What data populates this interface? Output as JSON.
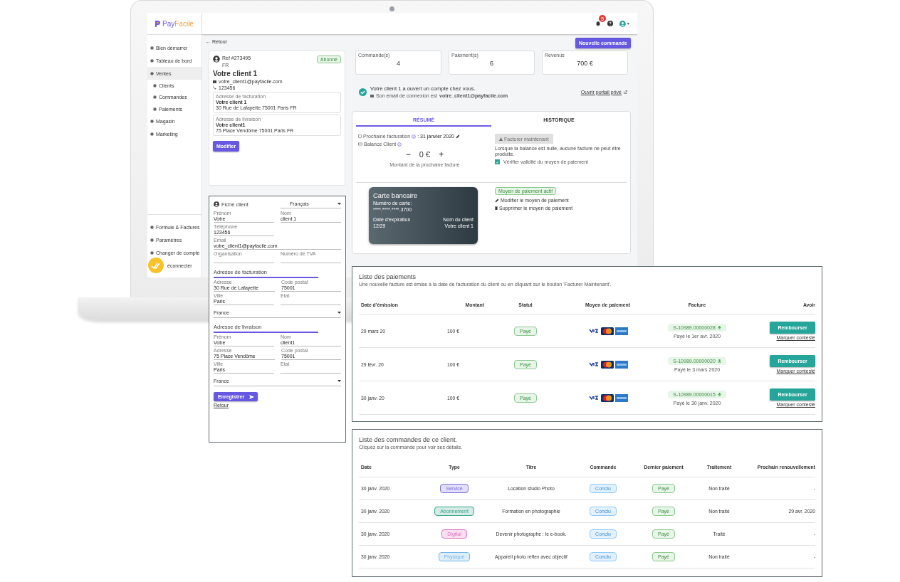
{
  "app": {
    "logo_parts": [
      "Pay",
      "Facile"
    ],
    "notifications_count": "5"
  },
  "sidebar": {
    "items": [
      {
        "label": "Bien démarrer",
        "selected": false
      },
      {
        "label": "Tableau de bord",
        "selected": false
      },
      {
        "label": "Ventes",
        "selected": true,
        "children": [
          {
            "label": "Clients",
            "selected": false
          },
          {
            "label": "Commandes",
            "selected": false
          },
          {
            "label": "Paiements",
            "selected": false
          }
        ]
      },
      {
        "label": "Magasin",
        "selected": false
      },
      {
        "label": "Marketing",
        "selected": false
      }
    ],
    "bottom_items": [
      "Formule & Factures",
      "Paramètres",
      "Changer de compte",
      "éconnecter"
    ]
  },
  "back_link": "← Retour",
  "new_order_button": "Nouvelle commande",
  "client": {
    "ref": "Ref #273495",
    "country": "FR",
    "status": "Abonné",
    "name": "Votre client 1",
    "email": "votre_client1@payfacile.com",
    "phone": "123456",
    "billing": {
      "label": "Adresse de facturation",
      "name": "Votre client 1",
      "address": "30 Rue de Lafayette 75001 Paris FR"
    },
    "shipping": {
      "label": "Adresse de livraison",
      "name": "Votre client1",
      "address": "75 Place Vendôme 75001 Paris FR"
    },
    "edit_button": "Modifier"
  },
  "stats": [
    {
      "label": "Commande(s)",
      "value": "4"
    },
    {
      "label": "Paiement(s)",
      "value": "6"
    },
    {
      "label": "Revenus",
      "value": "700 €"
    }
  ],
  "account_notice": {
    "title": "Votre client 1 a ouvert un compte chez vous.",
    "login_label": "Son email de connexion est",
    "login_email": "votre_client1@payfacile.com",
    "portal_link": "Ouvrir portail privé"
  },
  "tabs": [
    {
      "label": "RÉSUMÉ",
      "selected": true
    },
    {
      "label": "HISTORIQUE",
      "selected": false
    }
  ],
  "summary": {
    "next_billing_label": "Prochaine facturation",
    "next_billing_date": ": 31 janvier 2020",
    "balance_label": "Balance Client",
    "balance_minus": "−",
    "balance_value": "0 €",
    "balance_plus": "+",
    "balance_caption": "Montant de la prochaine facture",
    "bill_now": {
      "label": "Facturer maintenant",
      "disabled": true
    },
    "bill_note": "Lorsque la balance est nulle, aucune facture ne peut être produite.",
    "verify": {
      "label": "Vérifier validité du moyen de paiement",
      "checked": true
    }
  },
  "card": {
    "title": "Carte bancaire",
    "number_label": "Numéro de carte:",
    "number": "****.****.****.3700",
    "expiry_label": "Date d'expiration",
    "expiry": "12/29",
    "holder_label": "Nom du client",
    "holder": "Votre client 1"
  },
  "payment_method": {
    "status": "Moyen de paiement actif",
    "actions": [
      "Modifier le moyen de paiement",
      "Supprimer le moyen de paiement"
    ]
  },
  "fiche": {
    "title": "Fiche client",
    "language": "Français",
    "rows": [
      {
        "kind": "pair",
        "fields": [
          {
            "label": "Prénom",
            "value": "Votre"
          },
          {
            "label": "Nom",
            "value": "client 1"
          }
        ]
      },
      {
        "kind": "single",
        "fields": [
          {
            "label": "Téléphone",
            "value": "123456"
          }
        ]
      },
      {
        "kind": "full",
        "fields": [
          {
            "label": "Email",
            "value": "votre_client1@payfacile.com"
          }
        ]
      },
      {
        "kind": "pair",
        "fields": [
          {
            "label": "Organisation"
          },
          {
            "label": "Numéro de TVA"
          }
        ]
      },
      {
        "kind": "heading",
        "label": "Adresse de facturation"
      },
      {
        "kind": "wide",
        "fields": [
          {
            "label": "Adresse",
            "value": "30 Rue de Lafayette"
          },
          {
            "label": "Code postal",
            "value": "75001"
          }
        ]
      },
      {
        "kind": "pair",
        "fields": [
          {
            "label": "Ville",
            "value": "Paris"
          },
          {
            "label": "Etat"
          }
        ]
      },
      {
        "kind": "select",
        "value": "France"
      },
      {
        "kind": "heading",
        "label": "Adresse de livraison"
      },
      {
        "kind": "pair",
        "fields": [
          {
            "label": "Prénom",
            "value": "Votre"
          },
          {
            "label": "Nom",
            "value": "client1"
          }
        ]
      },
      {
        "kind": "wide",
        "fields": [
          {
            "label": "Adresse",
            "value": "75 Place Vendôme"
          },
          {
            "label": "Code postal",
            "value": "75001"
          }
        ]
      },
      {
        "kind": "pair",
        "fields": [
          {
            "label": "Ville",
            "value": "Paris"
          },
          {
            "label": "Etat"
          }
        ]
      },
      {
        "kind": "select",
        "value": "France"
      }
    ],
    "save_button": "Enregistrer",
    "back_link": "Retour"
  },
  "payments": {
    "title": "Liste des paiements",
    "subtitle": "Une nouvelle facture est émise à la date de facturation du client ou en cliquant sur le bouton 'Facturer Maintenant'.",
    "columns": [
      "Date d'émission",
      "Montant",
      "Statut",
      "Moyen de paiement",
      "Facture",
      "Avoir"
    ],
    "rows": [
      {
        "date": "29 mars 20",
        "amount": "100 €",
        "status": "Payé",
        "invoice": "S-10989.00000028",
        "paid_on": "Payé le 1er avr. 2020",
        "refund_button": "Rembourser",
        "dispute_link": "Marquer contesté"
      },
      {
        "date": "29 févr. 20",
        "amount": "100 €",
        "status": "Payé",
        "invoice": "S-10989.00000020",
        "paid_on": "Payé le 3 mars 2020",
        "refund_button": "Rembourser",
        "dispute_link": "Marquer contesté"
      },
      {
        "date": "30 janv. 20",
        "amount": "100 €",
        "status": "Payé",
        "invoice": "S-10989.00000015",
        "paid_on": "Payé le 30 janv. 2020",
        "refund_button": "Rembourser",
        "dispute_link": "Marquer contesté"
      }
    ]
  },
  "orders": {
    "title": "Liste des commandes de ce client.",
    "subtitle": "Cliquez sur la commande pour voir ses détails.",
    "columns": [
      "Date",
      "Type",
      "Titre",
      "Commande",
      "Dernier paiement",
      "Traitement",
      "Prochain renouvellement"
    ],
    "rows": [
      {
        "date": "30 janv. 2020",
        "type": {
          "label": "Service",
          "color": "#7b6fe0"
        },
        "title": "Location studio Photo",
        "order": "Conclu",
        "last_payment": "Payé",
        "processing": "Non traité",
        "renewal": "-"
      },
      {
        "date": "30 janv. 2020",
        "type": {
          "label": "Abonnement",
          "color": "#3aa58e"
        },
        "title": "Formation en photographie",
        "order": "Conclu",
        "last_payment": "Payé",
        "processing": "Non traité",
        "renewal": "29 avr. 2020"
      },
      {
        "date": "30 janv. 2020",
        "type": {
          "label": "Digital",
          "color": "#e06fbf"
        },
        "title": "Devenir photographe : le e-book.",
        "order": "Conclu",
        "last_payment": "Payé",
        "processing": "Traité",
        "renewal": "-"
      },
      {
        "date": "30 janv. 2020",
        "type": {
          "label": "Physique",
          "color": "#6fb5ea"
        },
        "title": "Appareil photo reflex avec objectif",
        "order": "Conclu",
        "last_payment": "Payé",
        "processing": "Non traité",
        "renewal": "-"
      }
    ]
  }
}
